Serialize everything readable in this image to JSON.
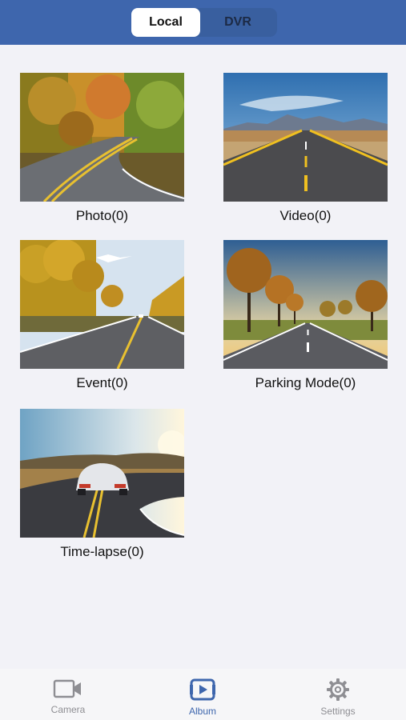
{
  "header": {
    "tabs": [
      {
        "label": "Local",
        "selected": true
      },
      {
        "label": "DVR",
        "selected": false
      }
    ]
  },
  "albums": [
    {
      "label": "Photo(0)",
      "thumbnail": "autumn-winding-road"
    },
    {
      "label": "Video(0)",
      "thumbnail": "desert-highway-mountains"
    },
    {
      "label": "Event(0)",
      "thumbnail": "golden-forest-road"
    },
    {
      "label": "Parking Mode(0)",
      "thumbnail": "tree-lined-road-sunset"
    },
    {
      "label": "Time-lapse(0)",
      "thumbnail": "sports-car-on-road"
    }
  ],
  "tabbar": {
    "items": [
      {
        "label": "Camera",
        "icon": "video-camera-icon",
        "active": false
      },
      {
        "label": "Album",
        "icon": "album-play-icon",
        "active": true
      },
      {
        "label": "Settings",
        "icon": "gear-icon",
        "active": false
      }
    ]
  },
  "colors": {
    "header_bg": "#3e66ad",
    "page_bg": "#f2f2f7",
    "active_tab": "#3e66ad",
    "inactive_tab": "#8e8e93"
  }
}
